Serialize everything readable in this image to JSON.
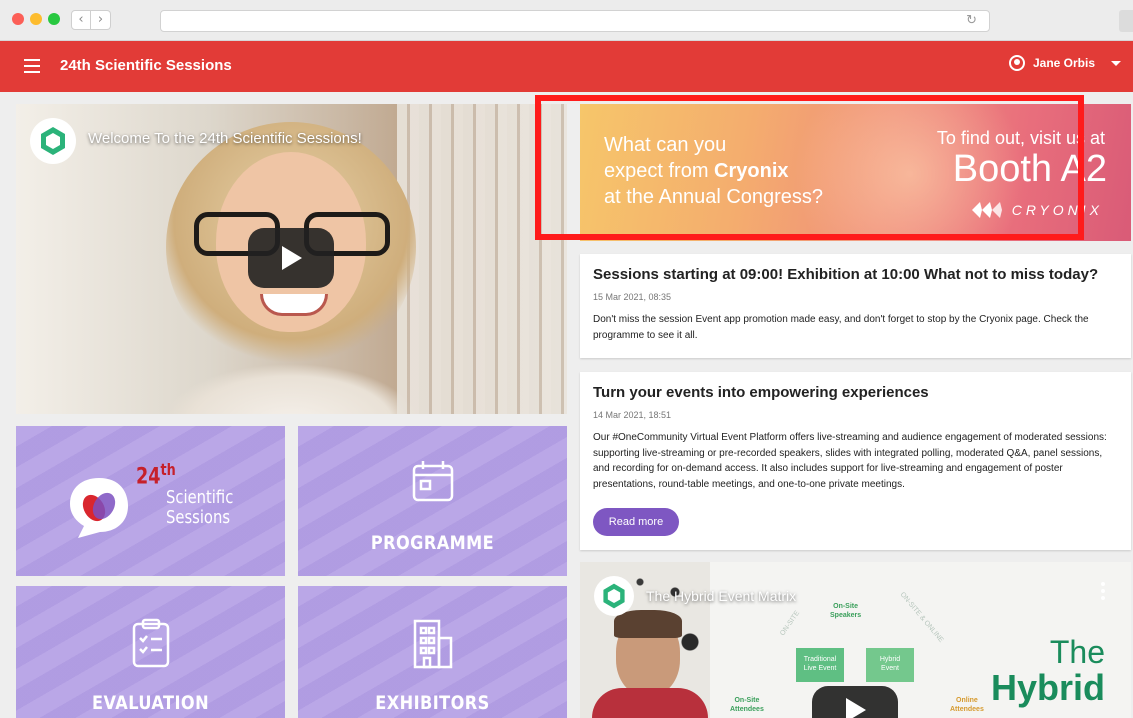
{
  "app": {
    "title": "24th Scientific Sessions",
    "user_name": "Jane Orbis"
  },
  "colors": {
    "appbar": "#e23b37",
    "tile": "#b6a2e6",
    "accent_button": "#7e57c2",
    "highlight": "#ff1b1b"
  },
  "video_main": {
    "title": "Welcome To the 24th Scientific Sessions!"
  },
  "tiles": [
    {
      "label": "",
      "logo_sup": "24",
      "logo_sup_th": "th",
      "logo_line1": "Scientific",
      "logo_line2": "Sessions"
    },
    {
      "label": "PROGRAMME",
      "icon": "calendar-icon"
    },
    {
      "label": "EVALUATION",
      "icon": "clipboard-checklist-icon"
    },
    {
      "label": "EXHIBITORS",
      "icon": "building-icon"
    }
  ],
  "banner": {
    "line1": "What can you",
    "line2_prefix": "expect from ",
    "line2_brand": "Cryonix",
    "line3": "at the Annual Congress?",
    "visit": "To find out, visit us at",
    "booth": "Booth A2",
    "brand": "CRYONIX"
  },
  "news": [
    {
      "title": "Sessions starting at 09:00! Exhibition at 10:00 What not to miss today?",
      "date": "15 Mar 2021, 08:35",
      "body": "Don't miss the session Event app promotion made easy, and don't forget to stop by the Cryonix page. Check the programme to see it all."
    },
    {
      "title": "Turn your events into empowering experiences",
      "date": "14 Mar 2021, 18:51",
      "body": "Our #OneCommunity Virtual Event Platform offers live-streaming and audience engagement of moderated sessions: supporting live-streaming or pre-recorded speakers, slides with integrated polling, moderated Q&A, panel sessions, and recording for on-demand access. It also includes support for live-streaming and engagement of poster presentations, round-table meetings, and one-to-one private meetings.",
      "button": "Read more"
    }
  ],
  "video_second": {
    "title": "The Hybrid Event Matrix",
    "onsite_speakers": "On-Site\nSpeakers",
    "onsite_attendees": "On-Site\nAttendees",
    "online_attendees": "Online\nAttendees",
    "box1": "Traditional\nLive Event",
    "box2": "Hybrid\nEvent",
    "diag_onsite": "ON-SITE",
    "diag_online": "ON-SITE & ONLINE",
    "big_title_1": "The",
    "big_title_2": "Hybrid"
  }
}
